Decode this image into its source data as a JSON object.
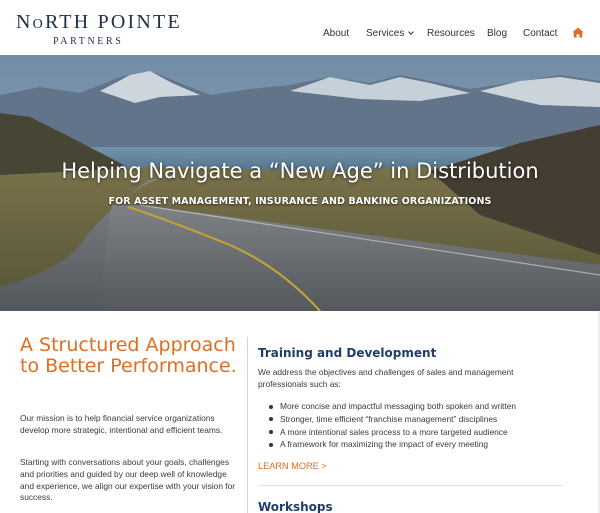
{
  "brand": {
    "logo_line1_prefix": "N",
    "logo_line1_o": "O",
    "logo_line1_rest": "RTH POINTE",
    "logo_line2": "PARTNERS"
  },
  "nav": {
    "about": "About",
    "services": "Services",
    "resources": "Resources",
    "blog": "Blog",
    "contact": "Contact",
    "home_icon": "home-icon",
    "accent": "#e06d20"
  },
  "hero": {
    "title": "Helping Navigate a “New Age” in Distribution",
    "subtitle": "FOR ASSET MANAGEMENT, INSURANCE AND BANKING ORGANIZATIONS"
  },
  "intro": {
    "heading": "A Structured Approach to Better Performance.",
    "paragraph1": "Our mission is to help financial service organizations develop more strategic, intentional and efficient teams.",
    "paragraph2": "Starting with conversations about your goals, challenges and priorities and guided by our deep well of knowledge and experience, we align our expertise with your vision for success."
  },
  "training": {
    "heading": "Training and Development",
    "intro": "We address the objectives and challenges of sales and management professionals such as:",
    "items": [
      "More concise and impactful messaging both spoken and written",
      "Stronger, time efficient “franchise management” disciplines",
      "A more intentional sales process to a more targeted audience",
      "A framework for maximizing the impact of every meeting"
    ],
    "learn_more": "LEARN MORE >"
  },
  "workshops": {
    "heading": "Workshops"
  },
  "colors": {
    "navy": "#1f2f4a",
    "heading_blue": "#1f3d6b",
    "orange": "#e06d20"
  }
}
